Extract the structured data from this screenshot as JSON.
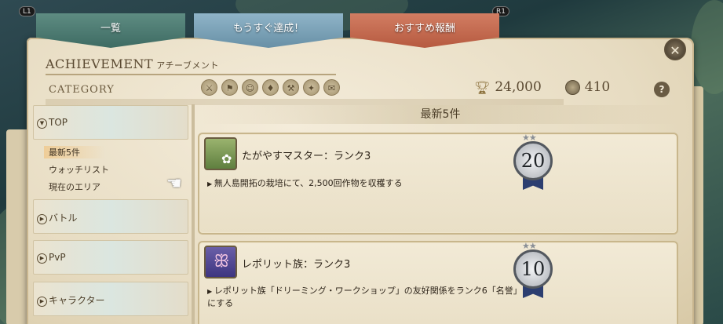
{
  "shoulder": {
    "left": "L1",
    "right": "R1"
  },
  "tabs": [
    {
      "label": "一覧",
      "color": "#4f7d74"
    },
    {
      "label": "もうすぐ達成！",
      "color": "#7ca2b8"
    },
    {
      "label": "おすすめ報酬",
      "color": "#c66c50"
    }
  ],
  "header": {
    "title": "ACHIEVEMENT",
    "subtitle": "アチーブメント"
  },
  "category": {
    "label": "CATEGORY",
    "icons": [
      "battle-icon",
      "pvp-icon",
      "character-icon",
      "items-icon",
      "crafting-icon",
      "exploration-icon",
      "quests-icon"
    ]
  },
  "points": {
    "achievement_points": "24,000",
    "coin_count": "410"
  },
  "sidebar": {
    "top_label": "TOP",
    "sub_items": [
      "最新5件",
      "ウォッチリスト",
      "現在のエリア"
    ],
    "items": [
      "バトル",
      "PvP",
      "キャラクター"
    ]
  },
  "main": {
    "list_title": "最新5件",
    "achievements": [
      {
        "name": "たがやすマスター：ランク3",
        "description": "無人島開拓の栽培にて、2,500回作物を収穫する",
        "points": "20",
        "stars": "★★",
        "icon": "crop-harvest-icon"
      },
      {
        "name": "レポリット族：ランク3",
        "description": "レポリット族「ドリーミング・ワークショップ」の友好関係をランク6「名誉」にする",
        "points": "10",
        "stars": "★★",
        "icon": "loporrit-icon"
      }
    ]
  }
}
